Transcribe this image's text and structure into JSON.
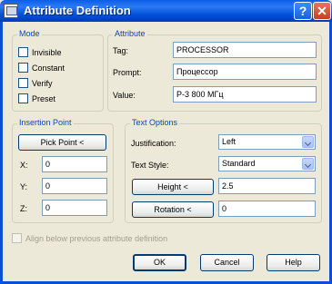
{
  "window": {
    "title": "Attribute Definition",
    "help_glyph": "?",
    "close_glyph": "✕"
  },
  "mode": {
    "legend": "Mode",
    "invisible": "Invisible",
    "constant": "Constant",
    "verify": "Verify",
    "preset": "Preset"
  },
  "attribute": {
    "legend": "Attribute",
    "tag_label": "Tag:",
    "tag_value": "PROCESSOR",
    "prompt_label": "Prompt:",
    "prompt_value": "Процессор",
    "value_label": "Value:",
    "value_value": "P-3 800 МГц"
  },
  "insertion_point": {
    "legend": "Insertion Point",
    "pick_button": "Pick Point <",
    "x_label": "X:",
    "x_value": "0",
    "y_label": "Y:",
    "y_value": "0",
    "z_label": "Z:",
    "z_value": "0"
  },
  "text_options": {
    "legend": "Text Options",
    "justification_label": "Justification:",
    "justification_value": "Left",
    "text_style_label": "Text Style:",
    "text_style_value": "Standard",
    "height_button": "Height <",
    "height_value": "2.5",
    "rotation_button": "Rotation <",
    "rotation_value": "0"
  },
  "align_below": "Align below previous attribute definition",
  "buttons": {
    "ok": "OK",
    "cancel": "Cancel",
    "help": "Help"
  }
}
